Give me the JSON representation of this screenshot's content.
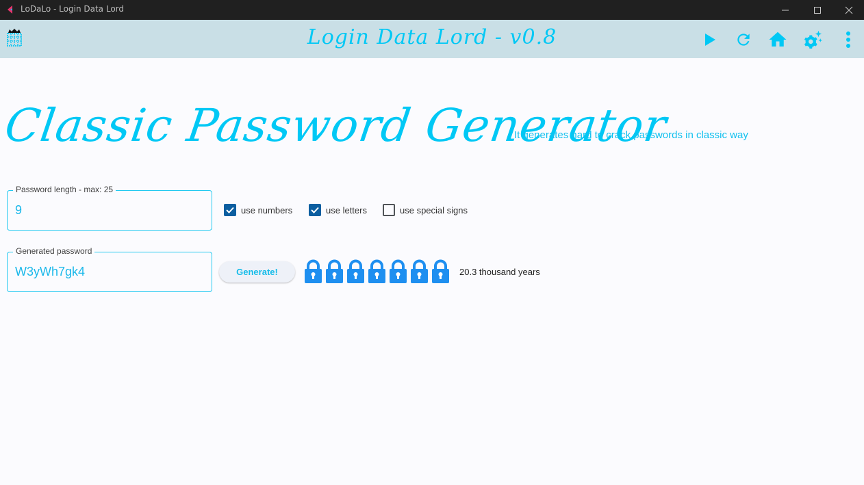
{
  "window": {
    "title": "LoDaLo - Login Data Lord",
    "controls": {
      "minimize": "minimize",
      "maximize": "maximize",
      "close": "close"
    }
  },
  "appbar": {
    "title": "Login Data Lord - v0.8",
    "logo_icon": "portcullis-icon",
    "actions": [
      {
        "name": "play",
        "icon": "play-icon"
      },
      {
        "name": "refresh",
        "icon": "refresh-icon"
      },
      {
        "name": "home",
        "icon": "home-icon"
      },
      {
        "name": "settings",
        "icon": "settings-sparkle-icon"
      },
      {
        "name": "more",
        "icon": "more-vertical-icon"
      }
    ]
  },
  "page": {
    "heading": "Classic Password Generator",
    "subtitle": "It generates hard to crack passwords in classic way"
  },
  "form": {
    "length_label": "Password length - max: 25",
    "length_value": "9",
    "options": [
      {
        "label": "use numbers",
        "checked": true
      },
      {
        "label": "use letters",
        "checked": true
      },
      {
        "label": "use special signs",
        "checked": false
      }
    ],
    "generated_label": "Generated password",
    "generated_value": "W3yWh7gk4",
    "generate_button": "Generate!",
    "strength_locks": 7,
    "crack_time": "20.3 thousand years"
  },
  "colors": {
    "accent": "#00c8f5",
    "appbar_bg": "#c9dfe6",
    "checkbox": "#0c5ea0",
    "lock": "#1e8ff0",
    "titlebar": "#202020"
  }
}
